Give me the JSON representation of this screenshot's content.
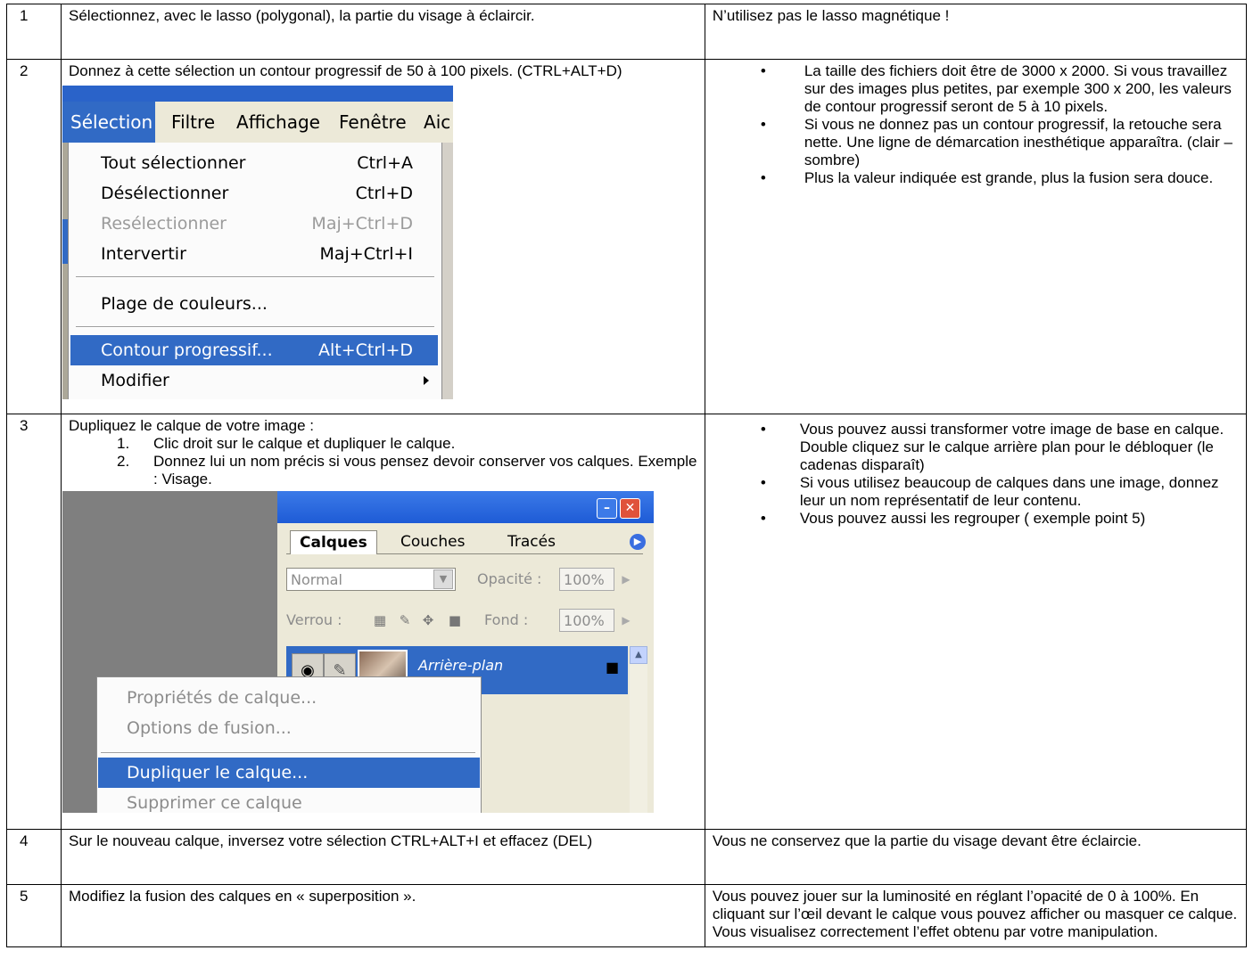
{
  "rows": [
    {
      "num": "1",
      "instruction": "Sélectionnez, avec le lasso (polygonal), la partie du visage à éclaircir.",
      "note": "N’utilisez pas le lasso magnétique !"
    },
    {
      "num": "2",
      "instruction": "Donnez à cette sélection un contour progressif de 50 à 100 pixels. (CTRL+ALT+D)",
      "notes": [
        "La taille des fichiers doit être de 3000 x 2000. Si vous travaillez sur des images plus petites, par exemple 300 x 200, les valeurs de contour progressif seront de 5 à 10 pixels.",
        "Si vous ne donnez pas un contour progressif, la retouche sera nette. Une ligne de démarcation inesthétique apparaîtra. (clair – sombre)",
        "Plus la valeur indiquée est grande, plus la fusion sera douce."
      ],
      "screenshot": {
        "menubar": [
          "Sélection",
          "Filtre",
          "Affichage",
          "Fenêtre",
          "Aic"
        ],
        "items": [
          {
            "label": "Tout sélectionner",
            "shortcut": "Ctrl+A"
          },
          {
            "label": "Désélectionner",
            "shortcut": "Ctrl+D"
          },
          {
            "label": "Resélectionner",
            "shortcut": "Maj+Ctrl+D"
          },
          {
            "label": "Intervertir",
            "shortcut": "Maj+Ctrl+I"
          },
          {
            "label": "Plage de couleurs..."
          },
          {
            "label": "Contour progressif...",
            "shortcut": "Alt+Ctrl+D"
          },
          {
            "label": "Modifier"
          }
        ]
      }
    },
    {
      "num": "3",
      "instruction": "Dupliquez le calque de votre image :",
      "steps": [
        {
          "n": "1.",
          "text": "Clic droit sur le calque et  dupliquer le calque."
        },
        {
          "n": "2.",
          "text": "Donnez lui un nom précis si vous pensez devoir conserver vos calques. Exemple : Visage."
        }
      ],
      "notes": [
        "Vous pouvez aussi transformer votre image de base en calque. Double cliquez sur le calque arrière plan pour le débloquer (le cadenas disparaît)",
        "Si vous utilisez beaucoup de calques dans une image, donnez leur un nom représentatif de leur contenu.",
        "Vous pouvez aussi les regrouper ( exemple point 5)"
      ],
      "screenshot": {
        "tabs": [
          "Calques",
          "Couches",
          "Tracés"
        ],
        "blend_mode": "Normal",
        "opacity_label": "Opacité :",
        "opacity_value": "100%",
        "lock_label": "Verrou :",
        "fill_label": "Fond :",
        "fill_value": "100%",
        "layer_name": "Arrière-plan",
        "context_menu": [
          "Propriétés de calque...",
          "Options de fusion...",
          "Dupliquer le calque...",
          "Supprimer ce calque"
        ]
      }
    },
    {
      "num": "4",
      "instruction": "Sur le nouveau calque, inversez votre sélection CTRL+ALT+I et effacez (DEL)",
      "note": "Vous ne conservez que la partie du visage devant être éclaircie."
    },
    {
      "num": "5",
      "instruction": "Modifiez la fusion des calques en « superposition ».",
      "note": "Vous pouvez jouer sur la luminosité en réglant l’opacité de 0 à 100%. En cliquant sur l’œil devant le calque vous pouvez afficher ou masquer ce calque. Vous visualisez correctement l’effet obtenu par votre manipulation."
    }
  ]
}
